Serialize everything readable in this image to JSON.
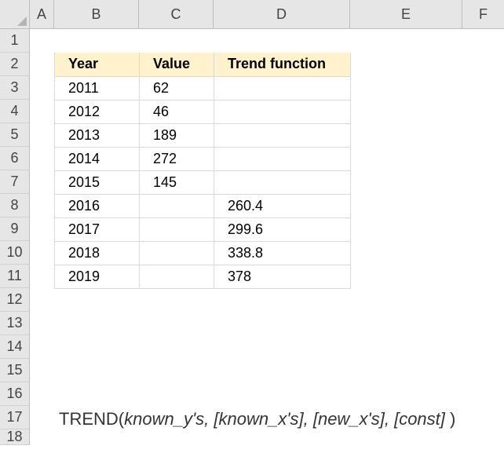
{
  "columns": [
    "A",
    "B",
    "C",
    "D",
    "E",
    "F"
  ],
  "rows": [
    "1",
    "2",
    "3",
    "4",
    "5",
    "6",
    "7",
    "8",
    "9",
    "10",
    "11",
    "12",
    "13",
    "14",
    "15",
    "16",
    "17",
    "18"
  ],
  "table": {
    "headers": [
      "Year",
      "Value",
      "Trend function"
    ],
    "rows": [
      [
        "2011",
        "62",
        ""
      ],
      [
        "2012",
        "46",
        ""
      ],
      [
        "2013",
        "189",
        ""
      ],
      [
        "2014",
        "272",
        ""
      ],
      [
        "2015",
        "145",
        ""
      ],
      [
        "2016",
        "",
        "260.4"
      ],
      [
        "2017",
        "",
        "299.6"
      ],
      [
        "2018",
        "",
        "338.8"
      ],
      [
        "2019",
        "",
        "378"
      ]
    ]
  },
  "formula": {
    "name": "TREND(",
    "args": "known_y's, [known_x's], [new_x's], [const]",
    "close": " )"
  },
  "colors": {
    "header_fill": "#fff2cc",
    "grid_header_bg": "#e6e6e6"
  }
}
